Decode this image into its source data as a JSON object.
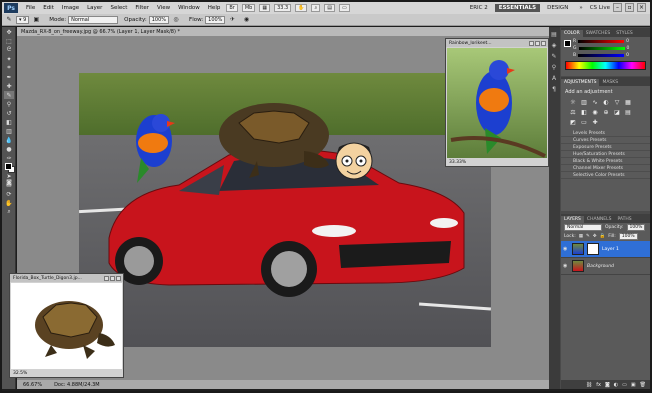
{
  "app": {
    "logo": "Ps",
    "menu": [
      "File",
      "Edit",
      "Image",
      "Layer",
      "Select",
      "Filter",
      "View",
      "Window",
      "Help"
    ],
    "zoom_select": "33.3",
    "workspace": [
      "ERIC 2",
      "ESSENTIALS",
      "DESIGN"
    ],
    "active_workspace": "ESSENTIALS",
    "cs_live": "CS Live"
  },
  "options": {
    "mode_label": "Mode:",
    "mode_value": "Normal",
    "opacity_label": "Opacity:",
    "opacity_value": "100%",
    "flow_label": "Flow:",
    "flow_value": "100%"
  },
  "document": {
    "tab_title": "Mazda_RX-8_on_freeway.jpg @ 66.7% (Layer 1, Layer Mask/8) *",
    "status_zoom": "66.67%",
    "status_doc": "Doc: 4.88M/24.3M"
  },
  "floats": {
    "parrot_title": "Rainbow_lorikeet...",
    "parrot_zoom": "33.33%",
    "turtle_title": "Florida_Box_Turtle_Digon3.jp...",
    "turtle_zoom": "32.5%"
  },
  "panels": {
    "color_tabs": [
      "COLOR",
      "SWATCHES",
      "STYLES"
    ],
    "color_values": [
      "0",
      "0",
      "0"
    ],
    "color_channels": [
      "R",
      "G",
      "B"
    ],
    "adjust_tabs": [
      "ADJUSTMENTS",
      "MASKS"
    ],
    "adjust_title": "Add an adjustment",
    "presets": [
      "Levels Presets",
      "Curves Presets",
      "Exposure Presets",
      "Hue/Saturation Presets",
      "Black & White Presets",
      "Channel Mixer Presets",
      "Selective Color Presets"
    ],
    "layer_tabs": [
      "LAYERS",
      "CHANNELS",
      "PATHS"
    ],
    "blend_mode": "Normal",
    "opacity_label": "Opacity:",
    "opacity_value": "100%",
    "lock_label": "Lock:",
    "fill_label": "Fill:",
    "fill_value": "100%",
    "layers": [
      "Layer 1",
      "Background"
    ],
    "selected_layer": "Layer 1"
  },
  "colors": {
    "selection": "#2f6fd6",
    "car_red": "#c8141c"
  }
}
